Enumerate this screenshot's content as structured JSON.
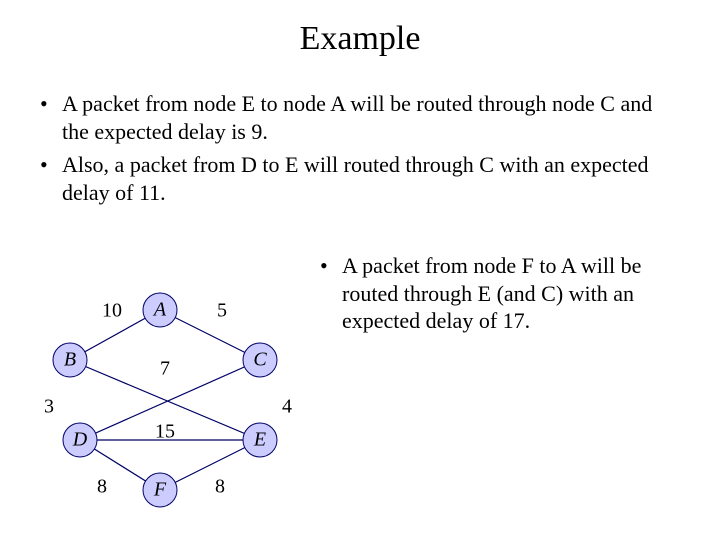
{
  "title": "Example",
  "bullets_top": [
    "A packet from node E to node A will be routed through node C and the expected delay is 9.",
    "Also, a packet from D to E will routed through C with an expected delay of 11."
  ],
  "bullets_right": [
    "A packet from node F to A will be routed through E (and C) with an expected delay of 17."
  ],
  "graph": {
    "nodes": {
      "A": "A",
      "B": "B",
      "C": "C",
      "D": "D",
      "E": "E",
      "F": "F"
    },
    "edge_labels": {
      "BA": "10",
      "AC": "5",
      "BE": "7",
      "DE": "15",
      "DF": "8",
      "FE": "8"
    },
    "side_labels": {
      "left": "3",
      "right": "4"
    }
  }
}
